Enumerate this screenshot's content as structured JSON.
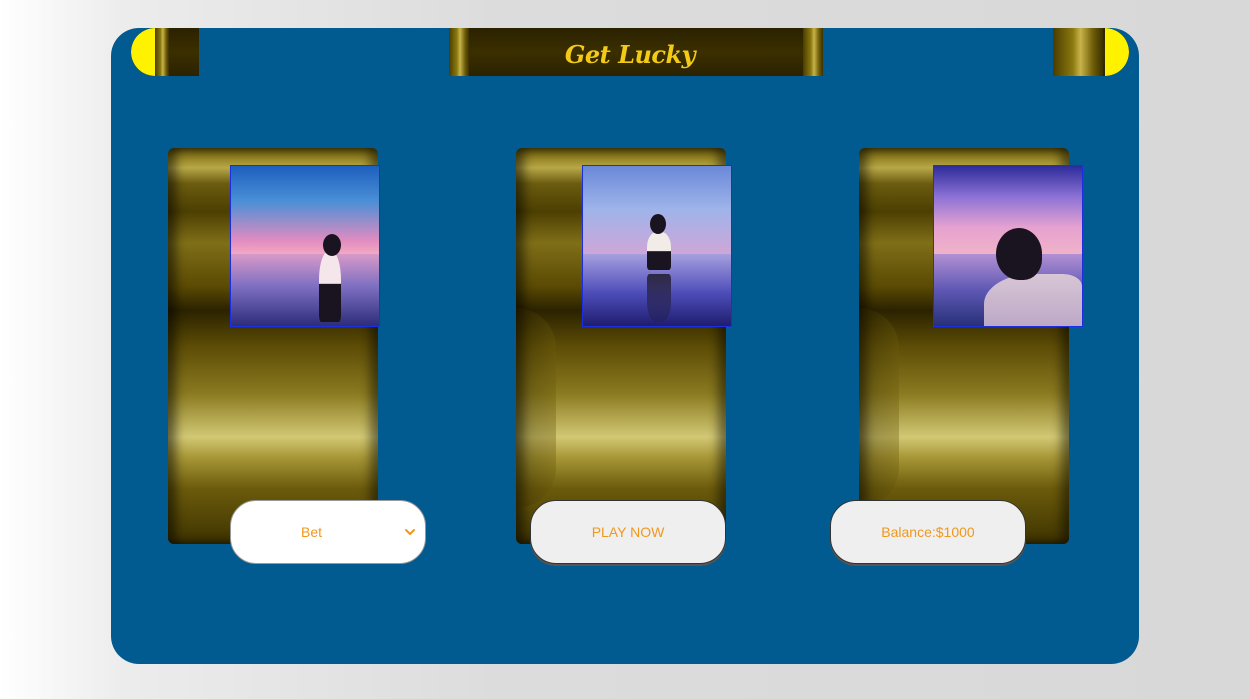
{
  "app": {
    "title": "Get Lucky"
  },
  "reels": [
    {
      "name": "reel-1",
      "image": "girl-on-beach-sunset"
    },
    {
      "name": "reel-2",
      "image": "girl-crouching-reflection"
    },
    {
      "name": "reel-3",
      "image": "girl-starry-sky"
    }
  ],
  "controls": {
    "bet_label": "Bet",
    "play_label": "PLAY NOW",
    "balance_label": "Balance:$1000"
  },
  "colors": {
    "machine_bg": "#015b90",
    "title": "#f3cb17",
    "cap": "#fff200",
    "control_text": "#f0981c"
  }
}
